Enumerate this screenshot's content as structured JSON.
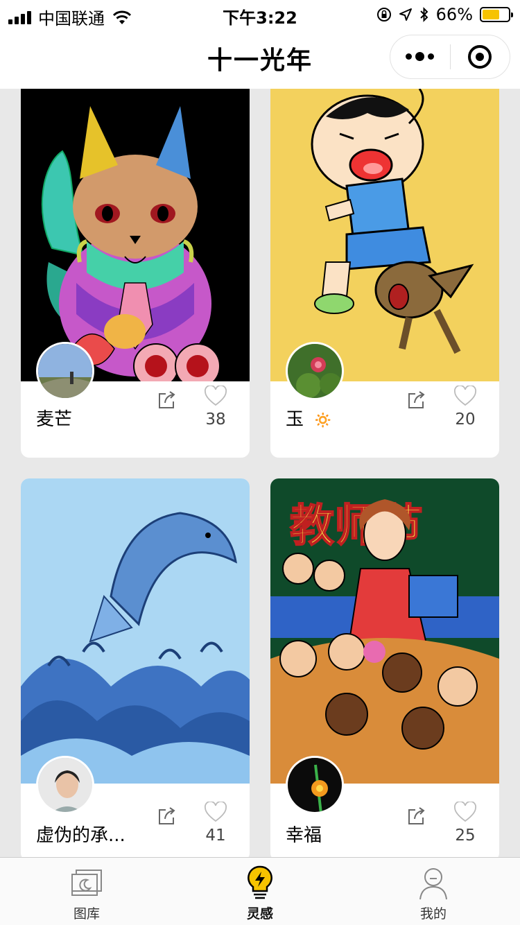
{
  "status_bar": {
    "carrier": "中国联通",
    "time": "下午3:22",
    "battery_percent": "66%",
    "battery_level": 0.66,
    "battery_color": "#f6c300",
    "icons": [
      "signal-icon",
      "wifi-icon",
      "rotation-lock-icon",
      "location-icon",
      "bluetooth-icon",
      "battery-icon"
    ]
  },
  "nav": {
    "title": "十一光年",
    "menu_icon": "more-dots-icon",
    "close_icon": "miniprogram-close-icon"
  },
  "feed": {
    "cards": [
      {
        "name": "麦芒",
        "likes": "38",
        "artwork": "zentangle-cat",
        "avatar": "landscape-photo"
      },
      {
        "name": "玉",
        "name_emoji": "🔅",
        "likes": "20",
        "artwork": "crying-boy-with-dog",
        "avatar": "red-flower-photo"
      },
      {
        "name": "虚伪的承...",
        "likes": "41",
        "artwork": "zentangle-dolphin-waves",
        "avatar": "girl-photo"
      },
      {
        "name": "幸福",
        "likes": "25",
        "artwork": "teachers-day-illustration",
        "artwork_text": "教师节",
        "avatar": "dark-flower-photo"
      }
    ],
    "card_actions": {
      "share_icon": "share-icon",
      "like_icon": "heart-icon"
    }
  },
  "tabbar": {
    "tabs": [
      {
        "label": "图库",
        "icon": "gallery-icon",
        "active": false
      },
      {
        "label": "灵感",
        "icon": "lightbulb-icon",
        "active": true
      },
      {
        "label": "我的",
        "icon": "user-icon",
        "active": false
      }
    ],
    "active_color": "#f6c300"
  }
}
